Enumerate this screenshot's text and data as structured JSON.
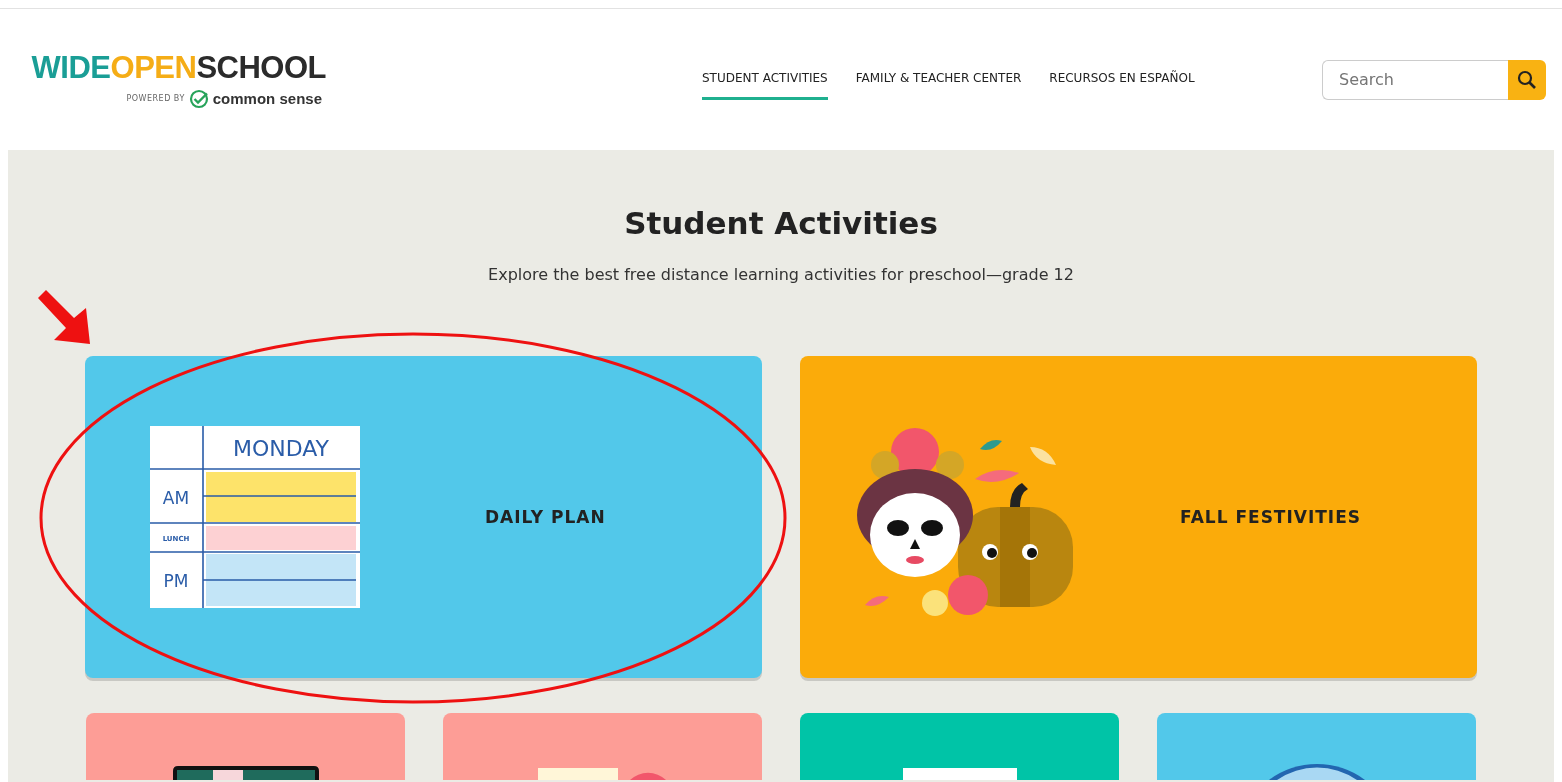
{
  "logo": {
    "parts": [
      {
        "text": "WIDE",
        "color": "#1a9e96"
      },
      {
        "text": "OPEN",
        "color": "#f5ad16"
      },
      {
        "text": "SCHOOL",
        "color": "#2b2b2b"
      }
    ],
    "powered_by": "POWERED BY",
    "brand": "common sense"
  },
  "nav": [
    {
      "label": "STUDENT ACTIVITIES",
      "selected": true
    },
    {
      "label": "FAMILY & TEACHER CENTER",
      "selected": false
    },
    {
      "label": "RECURSOS EN ESPAÑOL",
      "selected": false
    }
  ],
  "search": {
    "placeholder": "Search"
  },
  "hero": {
    "title": "Student Activities",
    "subtitle": "Explore the best free distance learning activities for preschool—grade 12"
  },
  "featured": [
    {
      "kind": "schedule",
      "label": "DAILY PLAN",
      "color": "#52c8ea",
      "schedule": {
        "day": "MONDAY",
        "rows": [
          "AM",
          "LUNCH",
          "PM"
        ]
      }
    },
    {
      "kind": "festivities",
      "label": "FALL FESTIVITIES",
      "color": "#fbab0a"
    }
  ],
  "more": [
    {
      "kind": "screen",
      "color": "#fd9d96"
    },
    {
      "kind": "calendar",
      "color": "#fd9d96"
    },
    {
      "kind": "paper",
      "color": "#00c4a7"
    },
    {
      "kind": "globe",
      "color": "#52c8ea"
    }
  ]
}
